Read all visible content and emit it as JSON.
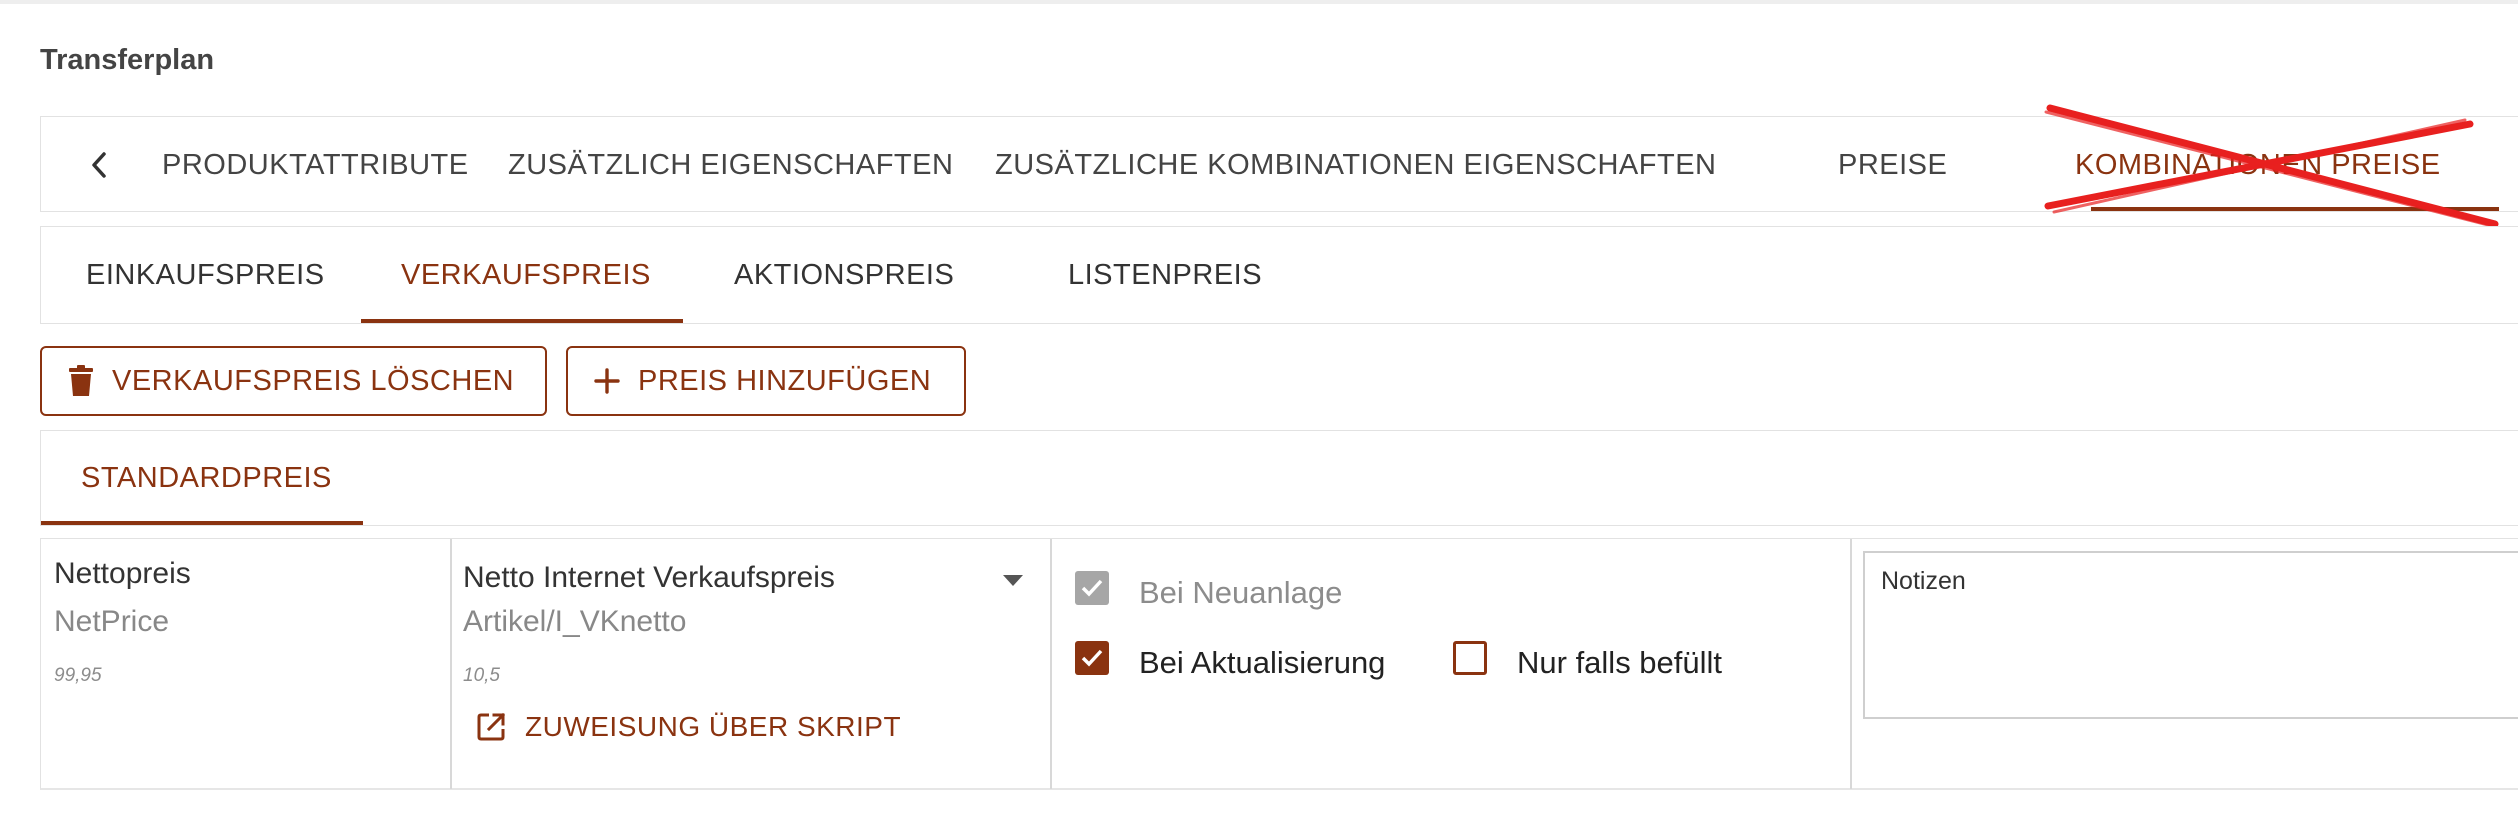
{
  "page": {
    "title": "Transferplan"
  },
  "main_tabs": [
    {
      "label": "PRODUKTATTRIBUTE"
    },
    {
      "label": "ZUSÄTZLICH EIGENSCHAFTEN"
    },
    {
      "label": "ZUSÄTZLICHE KOMBINATIONEN EIGENSCHAFTEN"
    },
    {
      "label": "PREISE"
    },
    {
      "label": "KOMBINATIONEN PREISE",
      "active": true,
      "crossed_out": true
    }
  ],
  "price_tabs": [
    {
      "label": "EINKAUFSPREIS"
    },
    {
      "label": "VERKAUFSPREIS",
      "active": true
    },
    {
      "label": "AKTIONSPREIS"
    },
    {
      "label": "LISTENPREIS"
    }
  ],
  "actions": {
    "delete_label": "VERKAUFSPREIS LÖSCHEN",
    "add_label": "PREIS HINZUFÜGEN"
  },
  "sub_tab": {
    "label": "STANDARDPREIS",
    "active": true
  },
  "mapping": {
    "source": {
      "label": "Nettopreis",
      "field": "NetPrice",
      "value": "99,95"
    },
    "target": {
      "label": "Netto Internet Verkaufspreis",
      "path": "Artikel/I_VKnetto",
      "value": "10,5",
      "script_link": "ZUWEISUNG ÜBER SKRIPT"
    },
    "options": {
      "on_create": {
        "label": "Bei Neuanlage",
        "checked": true,
        "disabled": true
      },
      "on_update": {
        "label": "Bei Aktualisierung",
        "checked": true
      },
      "only_if_filled": {
        "label": "Nur falls befüllt",
        "checked": false
      }
    },
    "notes": {
      "label": "Notizen",
      "value": ""
    }
  },
  "colors": {
    "accent": "#8a3310",
    "cross": "#e8201f",
    "disabled": "#a6a6a6"
  },
  "icons": [
    "chevron-left-icon",
    "trash-icon",
    "plus-icon",
    "open-in-new-icon",
    "check-icon",
    "dropdown-caret-icon"
  ]
}
